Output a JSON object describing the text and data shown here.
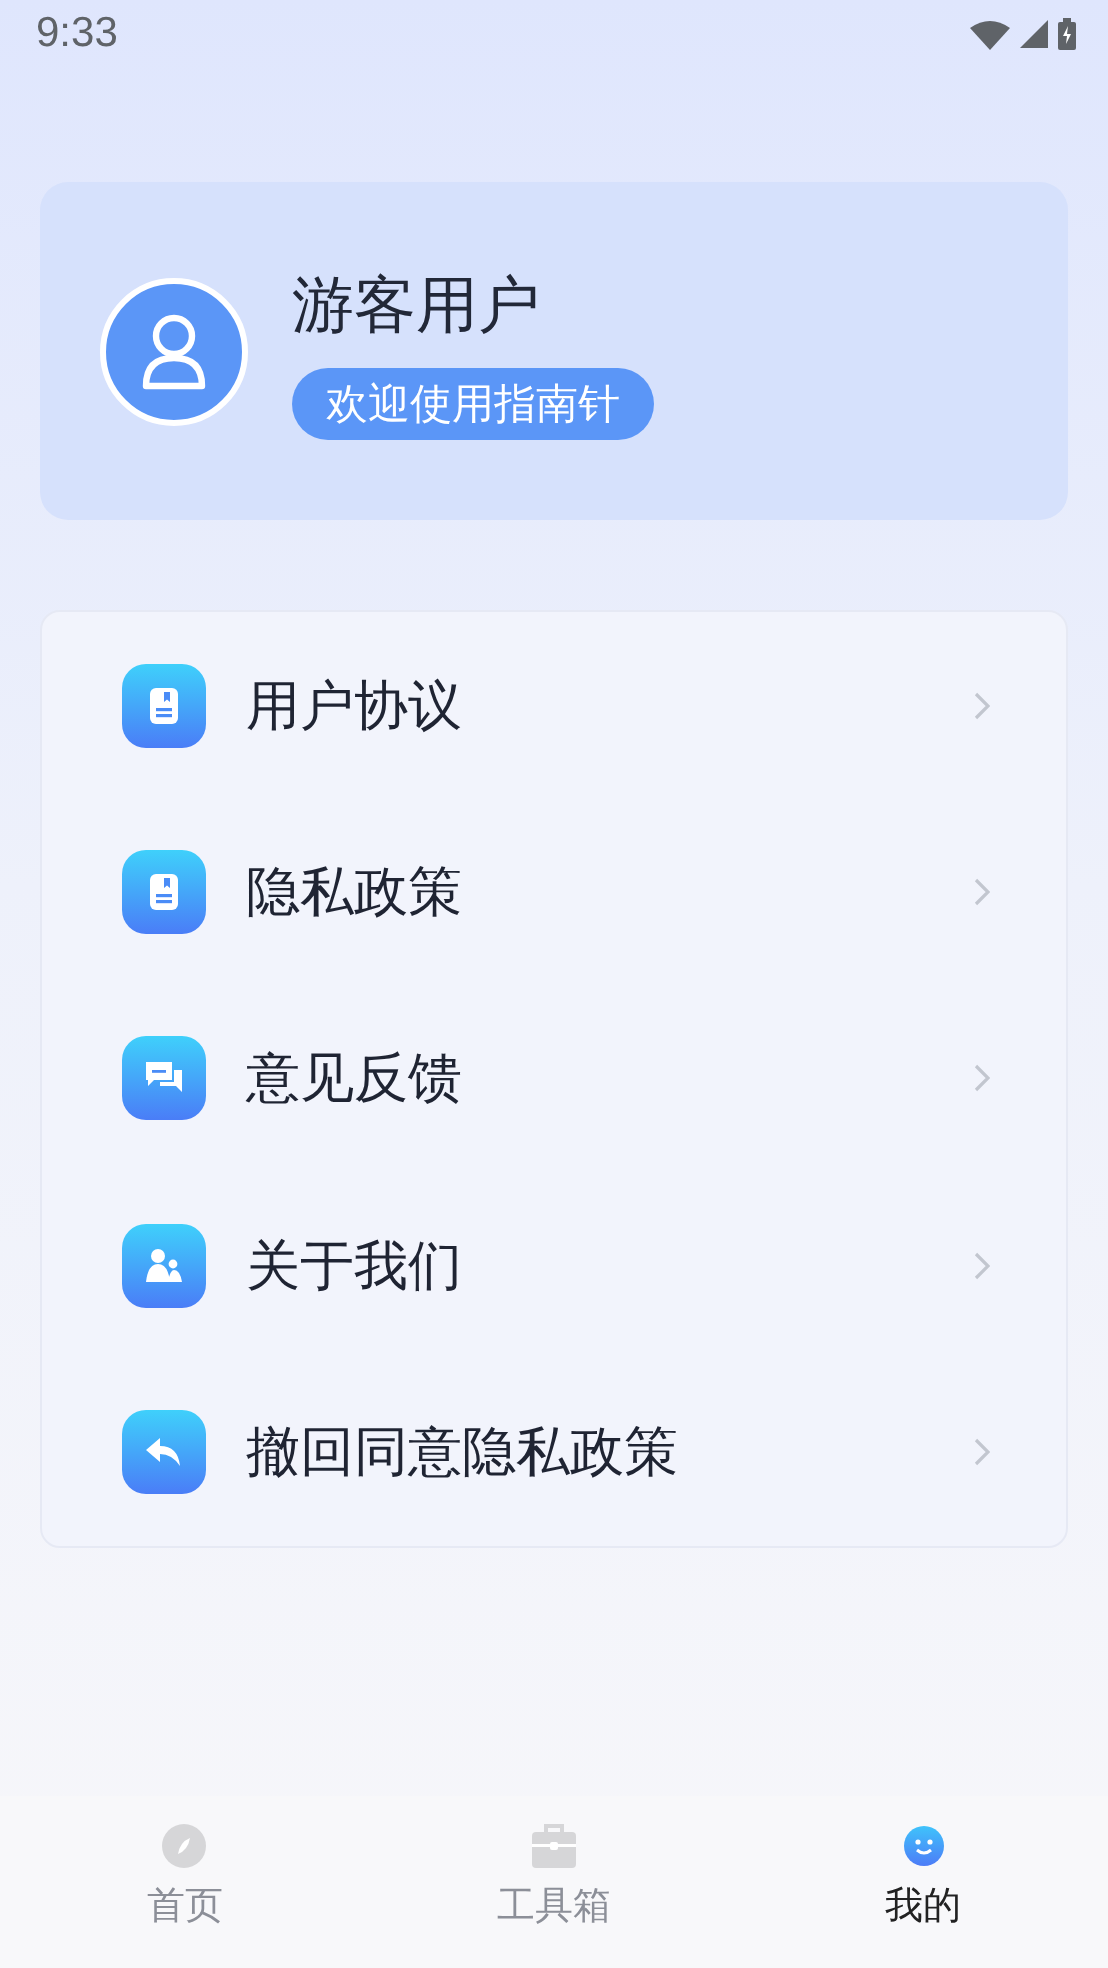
{
  "status_bar": {
    "time": "9:33"
  },
  "profile": {
    "name": "游客用户",
    "tagline": "欢迎使用指南针"
  },
  "menu": [
    {
      "kind": "document",
      "label": "用户协议"
    },
    {
      "kind": "document",
      "label": "隐私政策"
    },
    {
      "kind": "chat",
      "label": "意见反馈"
    },
    {
      "kind": "people",
      "label": "关于我们"
    },
    {
      "kind": "back",
      "label": "撤回同意隐私政策"
    }
  ],
  "tabs": [
    {
      "kind": "compass",
      "label": "首页",
      "selected": false
    },
    {
      "kind": "toolbox",
      "label": "工具箱",
      "selected": false
    },
    {
      "kind": "smiley",
      "label": "我的",
      "selected": true
    }
  ]
}
